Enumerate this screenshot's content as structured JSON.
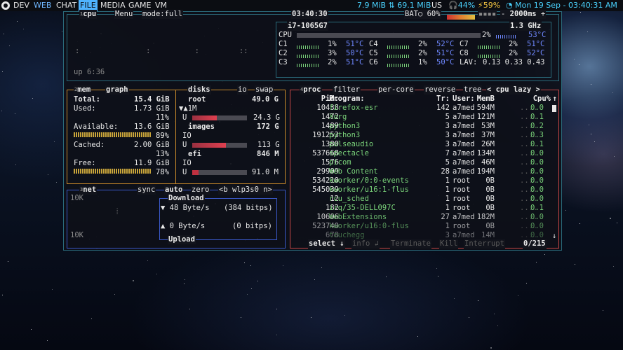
{
  "topbar": {
    "workspaces": [
      "DEV",
      "WEB",
      "CHAT",
      "FILE",
      "MEDIA",
      "GAME",
      "VM"
    ],
    "net_text": "7.9 MiB ⇅ 69.1 MiB",
    "layout": "US",
    "volume": "44%",
    "battery": "59%",
    "datetime": "Mon 19 Sep - 03:40:31 AM"
  },
  "cpu": {
    "title": "cpu",
    "menu": "Menu",
    "mode": "mode:full",
    "clock": "03:40:30",
    "battery": "BAT○ 60%",
    "interval": "2000ms",
    "model": "i7-1065G7",
    "freq": "1.3 GHz",
    "total_label": "CPU",
    "total_pct": "2%",
    "total_temp": "53°C",
    "cores": [
      {
        "name": "C1",
        "pct": "1%",
        "temp": "51°C"
      },
      {
        "name": "C2",
        "pct": "3%",
        "temp": "50°C"
      },
      {
        "name": "C3",
        "pct": "2%",
        "temp": "51°C"
      },
      {
        "name": "C4",
        "pct": "2%",
        "temp": "52°C"
      },
      {
        "name": "C5",
        "pct": "2%",
        "temp": "51°C"
      },
      {
        "name": "C6",
        "pct": "1%",
        "temp": "50°C"
      },
      {
        "name": "C7",
        "pct": "2%",
        "temp": "51°C"
      },
      {
        "name": "C8",
        "pct": "2%",
        "temp": "52°C"
      }
    ],
    "lav_label": "LAV:",
    "lav": "0.13 0.33 0.43",
    "uptime": "up 6:36"
  },
  "mem": {
    "title": "mem",
    "graph": "graph",
    "total_label": "Total:",
    "total": "15.4 GiB",
    "used_label": "Used:",
    "used": "1.73 GiB",
    "used_pct": "11%",
    "avail_label": "Available:",
    "avail": "13.6 GiB",
    "avail_pct": "89%",
    "cached_label": "Cached:",
    "cached": "2.00 GiB",
    "cached_pct": "13%",
    "free_label": "Free:",
    "free": "11.9 GiB",
    "free_pct": "78%"
  },
  "disks": {
    "title": "disks",
    "io": "io",
    "swap": "swap",
    "root": {
      "name": "root",
      "size": "49.0 G",
      "io_marker": "▼▲1M",
      "u_label": "U",
      "used": "24.3 G"
    },
    "images": {
      "name": "images",
      "size": "172 G",
      "io_label": "IO",
      "u_label": "U",
      "used": "113 G"
    },
    "efi": {
      "name": "efi",
      "size": "846 M",
      "io_label": "IO",
      "u_label": "U",
      "used": "91.0 M"
    }
  },
  "net": {
    "title": "net",
    "sync": "sync",
    "auto": "auto",
    "zero": "zero",
    "iface": "<b wlp3s0 n>",
    "top_scale": "10K",
    "bottom_scale": "10K",
    "download": "Download",
    "down_rate": "▼ 48 Byte/s",
    "down_bits": "(384 bitps)",
    "up_rate": "▲ 0 Byte/s",
    "up_bits": "(0 bitps)",
    "upload": "Upload"
  },
  "proc": {
    "title": "proc",
    "filter": "filter",
    "percore": "per-core",
    "reverse": "reverse",
    "tree": "tree",
    "sort": "< cpu lazy >",
    "headers": {
      "pid": "Pid:",
      "program": "Program:",
      "tr": "Tr:",
      "user": "User:",
      "memb": "MemB",
      "cpu": "Cpu%"
    },
    "rows": [
      {
        "pid": "10438",
        "prog": "firefox-esr",
        "tr": "142",
        "user": "a7med",
        "mem": "594M",
        "cpu": "0.0"
      },
      {
        "pid": "1472",
        "prog": "Xorg",
        "tr": "5",
        "user": "a7med",
        "mem": "121M",
        "cpu": "0.1"
      },
      {
        "pid": "1489",
        "prog": "python3",
        "tr": "3",
        "user": "a7med",
        "mem": "53M",
        "cpu": "0.2"
      },
      {
        "pid": "191253",
        "prog": "python3",
        "tr": "3",
        "user": "a7med",
        "mem": "37M",
        "cpu": "0.3"
      },
      {
        "pid": "1380",
        "prog": "pulseaudio",
        "tr": "3",
        "user": "a7med",
        "mem": "26M",
        "cpu": "0.1"
      },
      {
        "pid": "537668",
        "prog": "spectacle",
        "tr": "7",
        "user": "a7med",
        "mem": "134M",
        "cpu": "0.0"
      },
      {
        "pid": "1576",
        "prog": "picom",
        "tr": "5",
        "user": "a7med",
        "mem": "46M",
        "cpu": "0.0"
      },
      {
        "pid": "29909",
        "prog": "Web Content",
        "tr": "28",
        "user": "a7med",
        "mem": "194M",
        "cpu": "0.0"
      },
      {
        "pid": "534210",
        "prog": "kworker/0:0-events",
        "tr": "1",
        "user": "root",
        "mem": "0B",
        "cpu": "0.0"
      },
      {
        "pid": "545039",
        "prog": "kworker/u16:1-flus",
        "tr": "1",
        "user": "root",
        "mem": "0B",
        "cpu": "0.0"
      },
      {
        "pid": "12",
        "prog": "rcu_sched",
        "tr": "1",
        "user": "root",
        "mem": "0B",
        "cpu": "0.0"
      },
      {
        "pid": "182",
        "prog": "irq/35-DELL097C",
        "tr": "1",
        "user": "root",
        "mem": "0B",
        "cpu": "0.1"
      },
      {
        "pid": "10606",
        "prog": "WebExtensions",
        "tr": "27",
        "user": "a7med",
        "mem": "182M",
        "cpu": "0.0"
      },
      {
        "pid": "523740",
        "prog": "kworker/u16:0-flus",
        "tr": "1",
        "user": "root",
        "mem": "0B",
        "cpu": "0.0"
      },
      {
        "pid": "678",
        "prog": "touchegg",
        "tr": "3",
        "user": "a7med",
        "mem": "14M",
        "cpu": "0.0"
      }
    ],
    "select": "select ↓",
    "info": "info ↲",
    "terminate": "Terminate",
    "kill": "Kill",
    "interrupt": "Interrupt",
    "count": "0/215"
  },
  "colors": {
    "cpu_border": "#2a6a7a",
    "mem_border": "#c98a2a",
    "net_border": "#3a58c8",
    "proc_border": "#c44646"
  }
}
